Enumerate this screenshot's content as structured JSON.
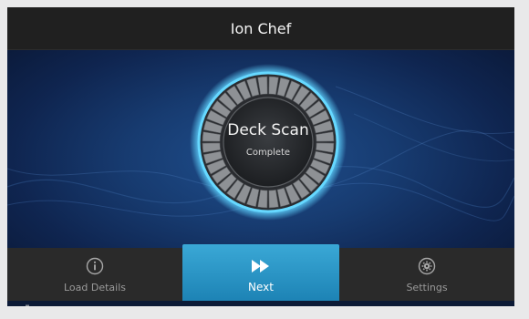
{
  "app": {
    "title": "Ion Chef"
  },
  "status_dial": {
    "title": "Deck Scan",
    "subtitle": "Complete"
  },
  "navbar": {
    "left": {
      "label": "Load Details",
      "icon": "info-icon"
    },
    "center": {
      "label": "Next",
      "icon": "fast-forward-icon"
    },
    "right": {
      "label": "Settings",
      "icon": "gear-icon"
    }
  },
  "statusbar": {
    "icon": "network-icon"
  },
  "colors": {
    "accent": "#2196c8",
    "background": "#0c1a36",
    "bar": "#2a2a2a",
    "glow": "#5fd3ff"
  }
}
